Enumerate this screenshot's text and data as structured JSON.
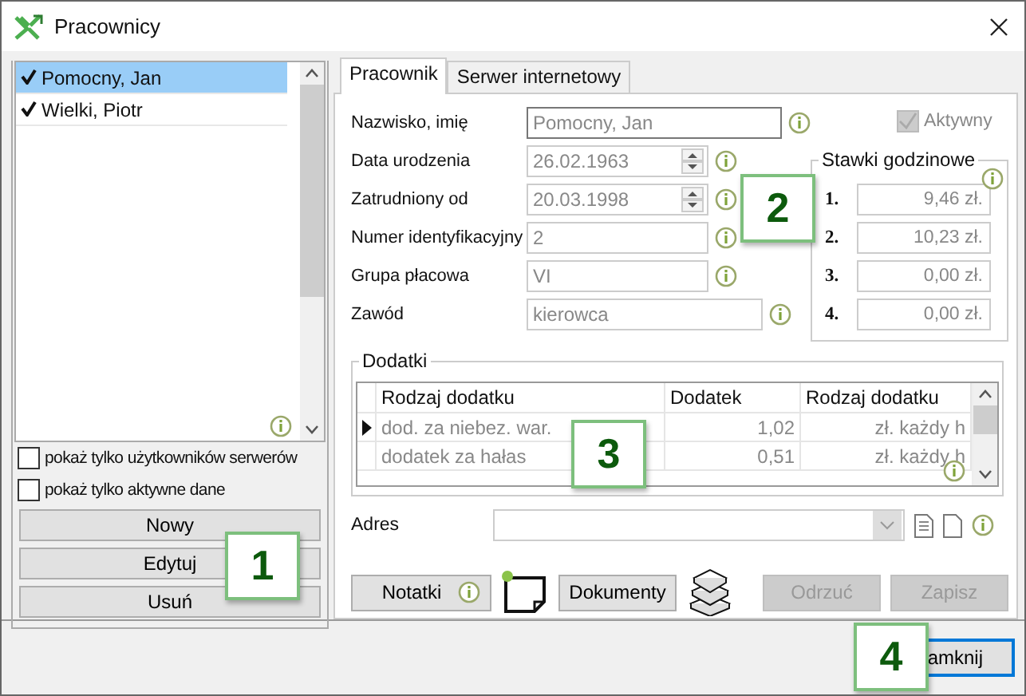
{
  "window": {
    "title": "Pracownicy"
  },
  "employees": [
    {
      "name": "Pomocny, Jan",
      "checked": true,
      "selected": true
    },
    {
      "name": "Wielki, Piotr",
      "checked": true,
      "selected": false
    }
  ],
  "filters": [
    {
      "label": "pokaż tylko użytkowników serwerów",
      "checked": false
    },
    {
      "label": "pokaż tylko aktywne dane",
      "checked": false
    }
  ],
  "left_buttons": [
    "Nowy",
    "Edytuj",
    "Usuń"
  ],
  "tabs": [
    {
      "label": "Pracownik",
      "selected": true
    },
    {
      "label": "Serwer internetowy",
      "selected": false
    }
  ],
  "fields": [
    {
      "label": "Nazwisko, imię",
      "value": "Pomocny, Jan",
      "kind": "text"
    },
    {
      "label": "Data urodzenia",
      "value": "26.02.1963",
      "kind": "date"
    },
    {
      "label": "Zatrudniony od",
      "value": "20.03.1998",
      "kind": "date"
    },
    {
      "label": "Numer identyfikacyjny",
      "value": "2",
      "kind": "text"
    },
    {
      "label": "Grupa płacowa",
      "value": "VI",
      "kind": "text"
    },
    {
      "label": "Zawód",
      "value": "kierowca",
      "kind": "text"
    }
  ],
  "active": {
    "label": "Aktywny",
    "checked": true,
    "disabled": true
  },
  "rates": {
    "title": "Stawki godzinowe",
    "items": [
      {
        "number": "1.",
        "value": "9,46 zł."
      },
      {
        "number": "2.",
        "value": "10,23 zł."
      },
      {
        "number": "3.",
        "value": "0,00 zł."
      },
      {
        "number": "4.",
        "value": "0,00 zł."
      }
    ]
  },
  "allowances": {
    "title": "Dodatki",
    "columns": [
      "Rodzaj dodatku",
      "Dodatek",
      "Rodzaj dodatku"
    ],
    "rows": [
      {
        "cells": [
          "dod. za niebez. war.",
          "1,02",
          "zł. każdy h"
        ],
        "current": true
      },
      {
        "cells": [
          "dodatek za hałas",
          "0,51",
          "zł. każdy h"
        ],
        "current": false
      }
    ]
  },
  "address": {
    "label": "Adres"
  },
  "notes_button": "Notatki",
  "documents_button": "Dokumenty",
  "actions": [
    {
      "label": "Odrzuć",
      "disabled": true
    },
    {
      "label": "Zapisz",
      "disabled": true
    }
  ],
  "close_button": "amknij",
  "callouts": [
    "1",
    "2",
    "3",
    "4"
  ]
}
